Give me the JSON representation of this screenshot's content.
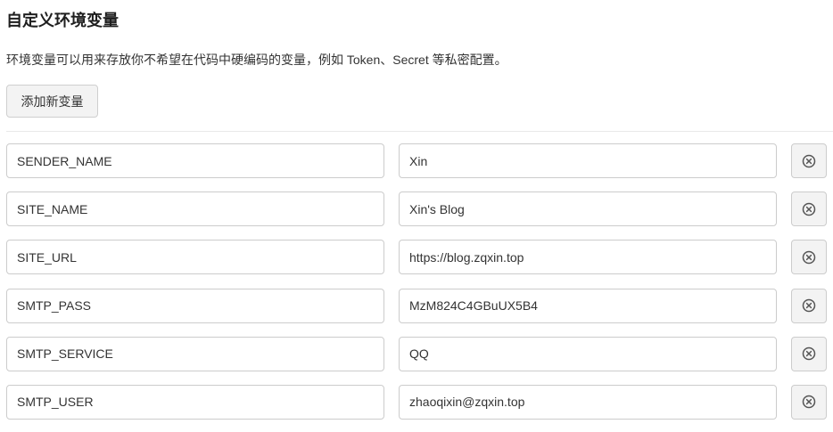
{
  "section": {
    "title": "自定义环境变量",
    "description": "环境变量可以用来存放你不希望在代码中硬编码的变量，例如 Token、Secret 等私密配置。",
    "add_button_label": "添加新变量"
  },
  "variables": [
    {
      "key": "SENDER_NAME",
      "value": "Xin"
    },
    {
      "key": "SITE_NAME",
      "value": "Xin's Blog"
    },
    {
      "key": "SITE_URL",
      "value": "https://blog.zqxin.top"
    },
    {
      "key": "SMTP_PASS",
      "value": "MzM824C4GBuUX5B4"
    },
    {
      "key": "SMTP_SERVICE",
      "value": "QQ"
    },
    {
      "key": "SMTP_USER",
      "value": "zhaoqixin@zqxin.top"
    }
  ],
  "icons": {
    "delete": "close-circle-icon"
  },
  "colors": {
    "border": "#cccccc",
    "button_bg": "#f3f3f3",
    "text": "#333333",
    "icon": "#555555"
  }
}
